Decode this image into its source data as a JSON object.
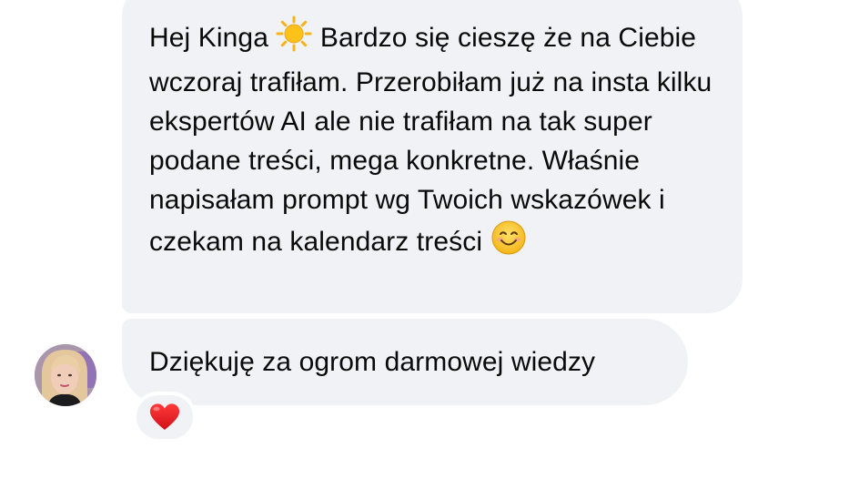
{
  "messages": [
    {
      "segments": [
        "Hej Kinga ",
        " Bardzo się cieszę że na Ciebie wczoraj trafiłam. Przerobiłam już na insta kilku ekspertów AI ale nie trafiłam na tak super podane treści, mega konkretne. Właśnie napisałam prompt wg Twoich wskazówek i czekam na kalendarz treści "
      ],
      "icons": [
        "sun-emoji-icon",
        "smiling-face-emoji-icon"
      ]
    },
    {
      "text": "Dziękuję za ogrom darmowej wiedzy",
      "reaction_icon": "red-heart-icon"
    }
  ],
  "sender": {
    "avatar_icon": "avatar-photo"
  },
  "colors": {
    "bubble": "#f1f2f5",
    "text": "#0a0a0a",
    "heart": "#e8161e"
  }
}
